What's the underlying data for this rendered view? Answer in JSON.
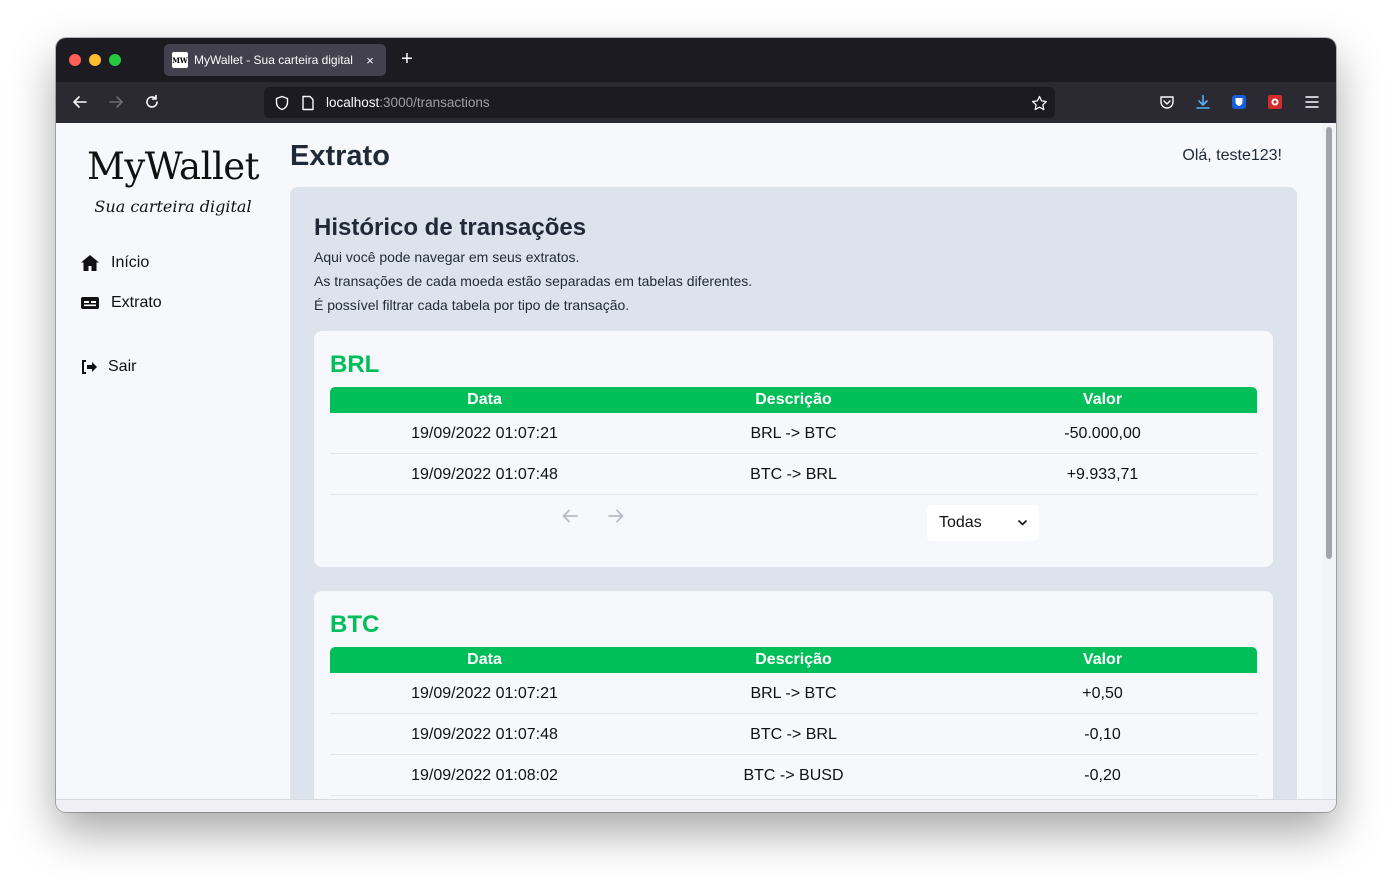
{
  "browser": {
    "tab_title": "MyWallet - Sua carteira digital",
    "favicon_text": "MW",
    "tab_close": "×",
    "new_tab": "+",
    "url_host": "localhost",
    "url_path": ":3000/transactions"
  },
  "sidebar": {
    "logo": "MyWallet",
    "tagline": "Sua carteira digital",
    "items": [
      {
        "label": "Início",
        "icon": "home-icon"
      },
      {
        "label": "Extrato",
        "icon": "statement-icon"
      }
    ],
    "logout": {
      "label": "Sair",
      "icon": "logout-icon"
    }
  },
  "header": {
    "title": "Extrato",
    "greeting": "Olá, teste123!"
  },
  "history": {
    "title": "Histórico de transações",
    "lines": [
      "Aqui você pode navegar em seus extratos.",
      "As transações de cada moeda estão separadas em tabelas diferentes.",
      "É possível filtrar cada tabela por tipo de transação."
    ]
  },
  "tables": [
    {
      "currency": "BRL",
      "columns": [
        "Data",
        "Descrição",
        "Valor"
      ],
      "rows": [
        [
          "19/09/2022 01:07:21",
          "BRL -> BTC",
          "-50.000,00"
        ],
        [
          "19/09/2022 01:07:48",
          "BTC -> BRL",
          "+9.933,71"
        ]
      ],
      "filter": "Todas"
    },
    {
      "currency": "BTC",
      "columns": [
        "Data",
        "Descrição",
        "Valor"
      ],
      "rows": [
        [
          "19/09/2022 01:07:21",
          "BRL -> BTC",
          "+0,50"
        ],
        [
          "19/09/2022 01:07:48",
          "BTC -> BRL",
          "-0,10"
        ],
        [
          "19/09/2022 01:08:02",
          "BTC -> BUSD",
          "-0,20"
        ]
      ]
    }
  ],
  "colors": {
    "accent": "#00bf59",
    "panel": "#dde3ed",
    "background": "#f6f8fb"
  }
}
